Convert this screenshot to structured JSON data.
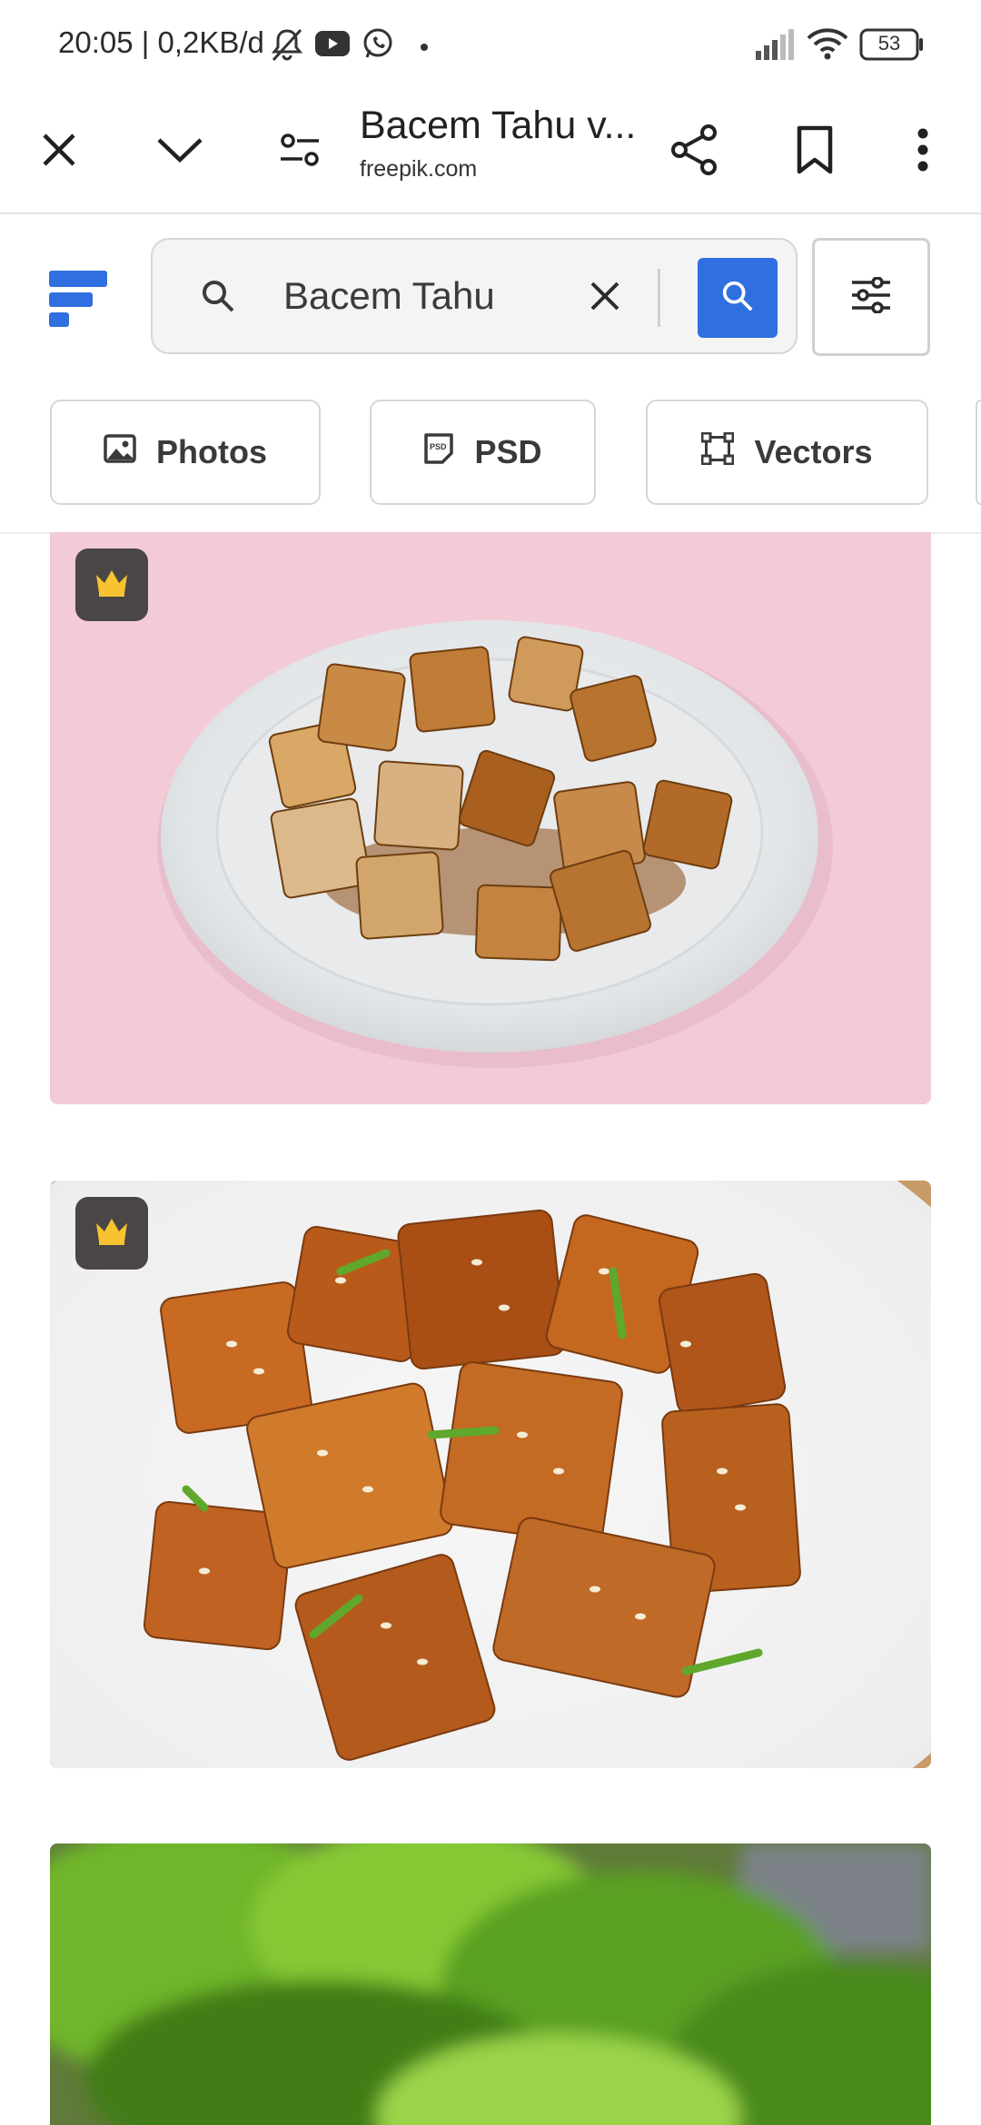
{
  "status_bar": {
    "time": "20:05 | 0,2KB/d",
    "battery": "53",
    "icons": [
      "mute-icon",
      "youtube-icon",
      "whatsapp-icon",
      "dot-icon",
      "signal-icon",
      "wifi-icon",
      "battery-icon"
    ]
  },
  "toolbar": {
    "title": "Bacem Tahu v...",
    "url": "freepik.com",
    "icons": [
      "close-icon",
      "chevron-down-icon",
      "page-settings-icon",
      "share-icon",
      "bookmark-icon",
      "more-vert-icon"
    ]
  },
  "site": {
    "brand_color": "#2f6fe0",
    "search": {
      "value": "Bacem Tahu",
      "placeholder": "Search"
    },
    "chips": [
      {
        "label": "Photos",
        "icon": "image-icon"
      },
      {
        "label": "PSD",
        "icon": "psd-icon"
      },
      {
        "label": "Vectors",
        "icon": "vector-icon"
      }
    ]
  },
  "results": [
    {
      "name": "tofu-plate-pink",
      "premium": true,
      "icon": "crown-icon"
    },
    {
      "name": "glazed-tofu-sesame",
      "premium": true,
      "icon": "crown-icon"
    },
    {
      "name": "lettuce-photo",
      "premium": false
    }
  ]
}
